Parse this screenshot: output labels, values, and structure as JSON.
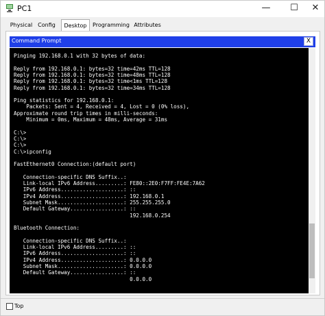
{
  "window": {
    "title": "PC1",
    "minimize": "—",
    "maximize": "☐",
    "close": "✕"
  },
  "tabs": [
    "Physical",
    "Config",
    "Desktop",
    "Programming",
    "Attributes"
  ],
  "active_tab": "Desktop",
  "command_prompt": {
    "title": "Command Prompt",
    "close_label": "X",
    "lines": [
      "Pinging 192.168.0.1 with 32 bytes of data:",
      "",
      "Reply from 192.168.0.1: bytes=32 time=42ms TTL=128",
      "Reply from 192.168.0.1: bytes=32 time=48ms TTL=128",
      "Reply from 192.168.0.1: bytes=32 time<1ms TTL=128",
      "Reply from 192.168.0.1: bytes=32 time=34ms TTL=128",
      "",
      "Ping statistics for 192.168.0.1:",
      "    Packets: Sent = 4, Received = 4, Lost = 0 (0% loss),",
      "Approximate round trip times in milli-seconds:",
      "    Minimum = 0ms, Maximum = 48ms, Average = 31ms",
      "",
      "C:\\>",
      "C:\\>",
      "C:\\>",
      "C:\\>ipconfig",
      "",
      "FastEthernet0 Connection:(default port)",
      "",
      "   Connection-specific DNS Suffix..: ",
      "   Link-local IPv6 Address.........: FE80::2E0:F7FF:FE4E:7A62",
      "   IPv6 Address....................: ::",
      "   IPv4 Address....................: 192.168.0.1",
      "   Subnet Mask.....................: 255.255.255.0",
      "   Default Gateway.................: ::",
      "                                     192.168.0.254",
      "",
      "Bluetooth Connection:",
      "",
      "   Connection-specific DNS Suffix..: ",
      "   Link-local IPv6 Address.........: ::",
      "   IPv6 Address....................: ::",
      "   IPv4 Address....................: 0.0.0.0",
      "   Subnet Mask.....................: 0.0.0.0",
      "   Default Gateway.................: ::",
      "                                     0.0.0.0"
    ]
  },
  "footer": {
    "top_label": "Top",
    "top_checked": false
  },
  "colors": {
    "cmd_header": "#1f3fe8",
    "console_bg": "#000000",
    "console_text": "#ffffff"
  }
}
